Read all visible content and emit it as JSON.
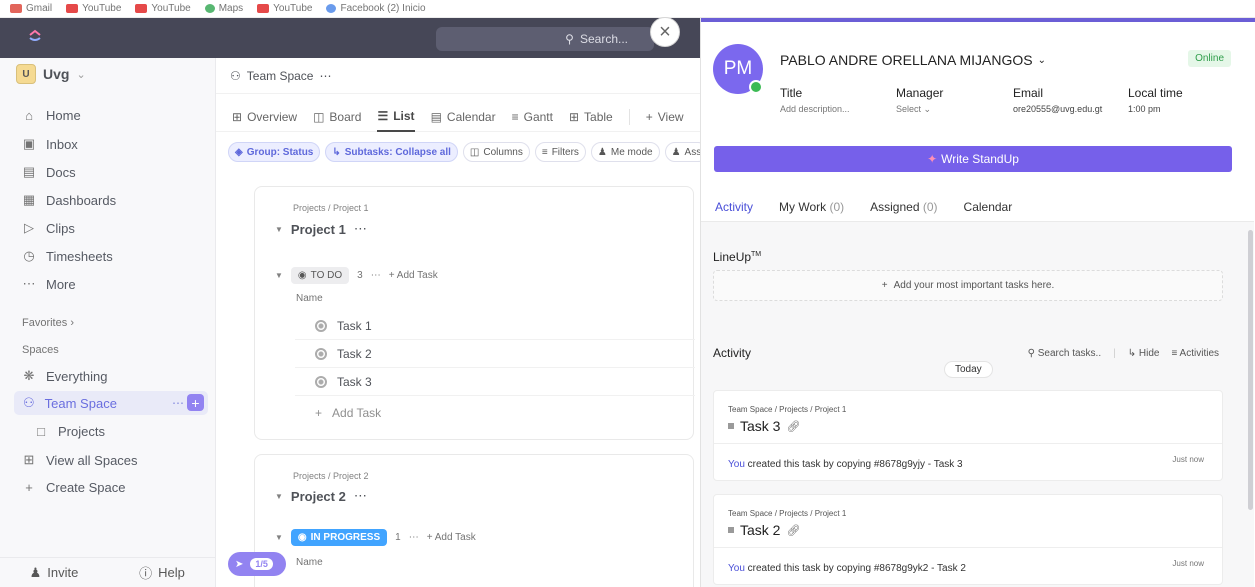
{
  "bookmarks": [
    "Gmail",
    "YouTube",
    "YouTube",
    "Maps",
    "YouTube",
    "Facebook (2) Inicio"
  ],
  "topbar": {
    "search_placeholder": "Search..."
  },
  "sidebar": {
    "workspace_badge": "U",
    "workspace_name": "Uvg",
    "nav": [
      "Home",
      "Inbox",
      "Docs",
      "Dashboards",
      "Clips",
      "Timesheets",
      "More"
    ],
    "favorites_label": "Favorites",
    "spaces_label": "Spaces",
    "everything": "Everything",
    "team_space": "Team Space",
    "projects": "Projects",
    "view_all_spaces": "View all Spaces",
    "create_space": "Create Space",
    "invite": "Invite",
    "help": "Help"
  },
  "main": {
    "space_title": "Team Space",
    "tabs": [
      "Overview",
      "Board",
      "List",
      "Calendar",
      "Gantt",
      "Table",
      "View"
    ],
    "active_tab": "List",
    "filters": [
      "Group: Status",
      "Subtasks: Collapse all",
      "Columns",
      "Filters",
      "Me mode",
      "Ass"
    ],
    "project1": {
      "path": "Projects / Project 1",
      "title": "Project 1",
      "status": "TO DO",
      "count": "3",
      "add_task": "Add Task",
      "name_header": "Name",
      "tasks": [
        "Task 1",
        "Task 2",
        "Task 3"
      ],
      "add_task_row": "Add Task"
    },
    "project2": {
      "path": "Projects / Project 2",
      "title": "Project 2",
      "status": "IN PROGRESS",
      "count": "1",
      "add_task": "Add Task",
      "name_header": "Name"
    },
    "launcher_badge": "1/5"
  },
  "panel": {
    "initials": "PM",
    "name": "PABLO ANDRE ORELLANA MIJANGOS",
    "status": "Online",
    "fields": {
      "title_label": "Title",
      "title_value": "Add description...",
      "manager_label": "Manager",
      "manager_value": "Select",
      "email_label": "Email",
      "email_value": "ore20555@uvg.edu.gt",
      "time_label": "Local time",
      "time_value": "1:00 pm"
    },
    "standup_button": "Write StandUp",
    "tabs": [
      {
        "label": "Activity",
        "count": ""
      },
      {
        "label": "My Work",
        "count": "(0)"
      },
      {
        "label": "Assigned",
        "count": "(0)"
      },
      {
        "label": "Calendar",
        "count": ""
      }
    ],
    "lineup_title": "LineUp",
    "lineup_tm": "TM",
    "lineup_add": "Add your most important tasks here.",
    "activity_title": "Activity",
    "search_tasks": "Search tasks..",
    "hide": "Hide",
    "activities": "Activities",
    "today": "Today",
    "feed": [
      {
        "path": "Team Space  /  Projects  /  Project 1",
        "title": "Task 3",
        "you": "You",
        "text": " created this task by copying  #8678g9yjy - Task 3",
        "time": "Just now"
      },
      {
        "path": "Team Space  /  Projects  /  Project 1",
        "title": "Task 2",
        "you": "You",
        "text": " created this task by copying  #8678g9yk2 - Task 2",
        "time": "Just now"
      }
    ]
  }
}
